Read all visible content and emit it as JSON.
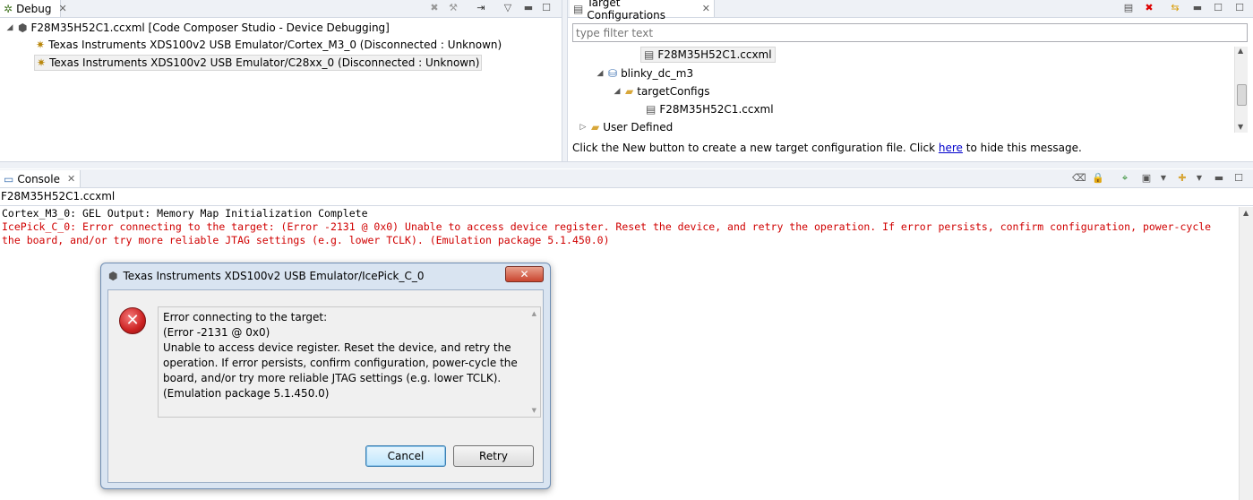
{
  "debug": {
    "tab_label": "Debug",
    "root": "F28M35H52C1.ccxml [Code Composer Studio - Device Debugging]",
    "children": [
      "Texas Instruments XDS100v2 USB Emulator/Cortex_M3_0 (Disconnected : Unknown)",
      "Texas Instruments XDS100v2 USB Emulator/C28xx_0 (Disconnected : Unknown)"
    ]
  },
  "target_configs": {
    "tab_label": "Target Configurations",
    "filter_placeholder": "type filter text",
    "items": [
      "F28M35H52C1.ccxml",
      "blinky_dc_m3",
      "targetConfigs",
      "F28M35H52C1.ccxml",
      "User Defined"
    ],
    "message_prefix": "Click the New button to create a new target configuration file. Click ",
    "message_link": "here",
    "message_suffix": " to hide this message."
  },
  "console": {
    "tab_label": "Console",
    "name": "F28M35H52C1.ccxml",
    "lines": [
      "Cortex_M3_0: GEL Output: Memory Map Initialization Complete",
      "IcePick_C_0: Error connecting to the target: (Error -2131 @ 0x0) Unable to access device register. Reset the device, and retry the operation. If error persists, confirm configuration, power-cycle",
      "the board, and/or try more reliable JTAG settings (e.g. lower TCLK). (Emulation package 5.1.450.0)"
    ]
  },
  "dialog": {
    "title": "Texas Instruments XDS100v2 USB Emulator/IcePick_C_0",
    "close_label": "✕",
    "message_lines": [
      "Error connecting to the target:",
      "(Error -2131 @ 0x0)",
      "Unable to access device register. Reset the device, and retry the",
      "operation. If error persists, confirm configuration, power-cycle the",
      "board, and/or try more reliable JTAG settings (e.g. lower TCLK).",
      "(Emulation package 5.1.450.0)"
    ],
    "cancel_label": "Cancel",
    "retry_label": "Retry"
  },
  "colors": {
    "error_text": "#d00000",
    "link": "#0000cc",
    "error_icon": "#cc2222"
  }
}
